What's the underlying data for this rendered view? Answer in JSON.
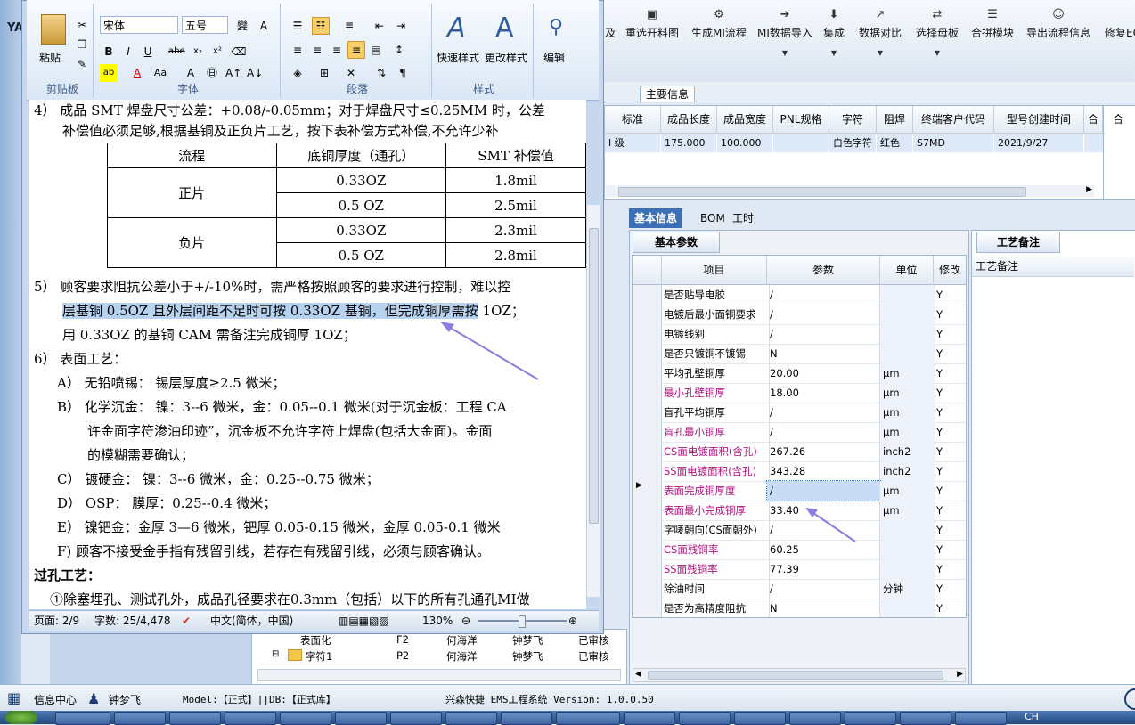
{
  "app": {
    "left_strip_label": "YA",
    "toolbar": [
      {
        "label": "及",
        "icon": "none"
      },
      {
        "label": "重选开料图",
        "icon": "picture-icon"
      },
      {
        "label": "生成MI流程",
        "icon": "flow-icon"
      },
      {
        "label": "MI数据导入",
        "icon": "import-icon"
      },
      {
        "label": "集成",
        "icon": "download-icon"
      },
      {
        "label": "数据对比",
        "icon": "compare-icon"
      },
      {
        "label": "选择母板",
        "icon": "shuffle-icon"
      },
      {
        "label": "合拼模块",
        "icon": "list-icon"
      },
      {
        "label": "导出流程信息",
        "icon": "smile-icon"
      },
      {
        "label": "修复ECR",
        "icon": "none"
      }
    ],
    "main_tab": "主要信息",
    "order_grid": {
      "headers": [
        "标准",
        "成品长度",
        "成品宽度",
        "PNL规格",
        "字符",
        "阻焊",
        "终端客户代码",
        "型号创建时间",
        "合"
      ],
      "row": [
        "I 级",
        "175.000",
        "100.000",
        "",
        "白色字符",
        "红色",
        "S7MD",
        "2021/9/27",
        ""
      ]
    },
    "right_panel_label": "合",
    "tabs": [
      "基本信息",
      "BOM",
      "工时"
    ],
    "basic_title": "基本参数",
    "param_headers": [
      "项目",
      "参数",
      "单位",
      "修改"
    ],
    "params": [
      {
        "name": "是否贴导电胶",
        "value": "/",
        "unit": "",
        "flag": "Y",
        "hl": false
      },
      {
        "name": "电镀后最小面铜要求",
        "value": "/",
        "unit": "",
        "flag": "Y",
        "hl": false
      },
      {
        "name": "电镀线别",
        "value": "/",
        "unit": "",
        "flag": "Y",
        "hl": false
      },
      {
        "name": "是否只镀铜不镀锡",
        "value": "N",
        "unit": "",
        "flag": "Y",
        "hl": false
      },
      {
        "name": "平均孔壁铜厚",
        "value": "20.00",
        "unit": "μm",
        "flag": "Y",
        "hl": false
      },
      {
        "name": "最小孔壁铜厚",
        "value": "18.00",
        "unit": "μm",
        "flag": "Y",
        "hl": true
      },
      {
        "name": "盲孔平均铜厚",
        "value": "/",
        "unit": "μm",
        "flag": "Y",
        "hl": false
      },
      {
        "name": "盲孔最小铜厚",
        "value": "/",
        "unit": "μm",
        "flag": "Y",
        "hl": true
      },
      {
        "name": "CS面电镀面积(含孔)",
        "value": "267.26",
        "unit": "inch2",
        "flag": "Y",
        "hl": true
      },
      {
        "name": "SS面电镀面积(含孔)",
        "value": "343.28",
        "unit": "inch2",
        "flag": "Y",
        "hl": true
      },
      {
        "name": "表面完成铜厚度",
        "value": "/",
        "unit": "μm",
        "flag": "Y",
        "hl": true
      },
      {
        "name": "表面最小完成铜厚",
        "value": "33.40",
        "unit": "μm",
        "flag": "Y",
        "hl": true
      },
      {
        "name": "字唛朝向(CS面朝外)",
        "value": "/",
        "unit": "",
        "flag": "Y",
        "hl": false
      },
      {
        "name": "CS面残铜率",
        "value": "60.25",
        "unit": "",
        "flag": "Y",
        "hl": true
      },
      {
        "name": "SS面残铜率",
        "value": "77.39",
        "unit": "",
        "flag": "Y",
        "hl": true
      },
      {
        "name": "除油时间",
        "value": "/",
        "unit": "分钟",
        "flag": "Y",
        "hl": false
      },
      {
        "name": "是否为高精度阻抗",
        "value": "N",
        "unit": "",
        "flag": "Y",
        "hl": false
      }
    ],
    "notes_title": "工艺备注",
    "notes_header": "工艺备注",
    "tree": [
      {
        "name": "表面化",
        "code": "F2",
        "p1": "何海洋",
        "p2": "钟梦飞",
        "status": "已审核"
      },
      {
        "name": "字符1",
        "code": "P2",
        "p1": "何海洋",
        "p2": "钟梦飞",
        "status": "已审核"
      }
    ],
    "status": {
      "info_center": "信息中心",
      "user": "钟梦飞",
      "model": "Model:【正式】||DB:【正式库】",
      "system": "兴森快捷 EMS工程系统 Version: 1.0.0.50"
    },
    "taskbar_clock": "CH"
  },
  "word": {
    "ribbon": {
      "clipboard_label": "剪贴板",
      "paste": "粘贴",
      "font_label": "字体",
      "font_name": "宋体",
      "font_size": "五号",
      "paragraph_label": "段落",
      "styles_label": "样式",
      "quick_style": "快速样式",
      "change_style": "更改样式",
      "edit": "编辑"
    },
    "doc": {
      "l1": "4） 成品 SMT 焊盘尺寸公差：+0.08/-0.05mm；对于焊盘尺寸≤0.25MM 时，公差",
      "l2": "补偿值必须足够,根据基铜及正负片工艺，按下表补偿方式补偿,不允许少补",
      "table_headers": [
        "流程",
        "底铜厚度（通孔）",
        "SMT 补偿值"
      ],
      "table_rows": [
        {
          "flow": "正片",
          "cu": "0.33OZ",
          "val": "1.8mil"
        },
        {
          "flow": "",
          "cu": "0.5 OZ",
          "val": "2.5mil"
        },
        {
          "flow": "负片",
          "cu": "0.33OZ",
          "val": "2.3mil"
        },
        {
          "flow": "",
          "cu": "0.5 OZ",
          "val": "2.8mil"
        }
      ],
      "l5a": "5） 顾客要求阻抗公差小于+/-10%时，需严格按照顾客的要求进行控制，难以控",
      "l5b_hl": "层基铜 0.5OZ 且外层间距不足时可按 0.33OZ 基铜，但完成铜厚需按",
      "l5b_tail": " 1OZ；",
      "l5c": "用 0.33OZ 的基铜 CAM 需备注完成铜厚 1OZ；",
      "l6": "6） 表面工艺：",
      "lA": "A） 无铅喷锡：  锡层厚度≥2.5 微米；",
      "lB": "B） 化学沉金：  镍：3--6 微米，金：0.05--0.1 微米(对于沉金板：工程 CA",
      "lB2": "许金面字符渗油印迹”，沉金板不允许字符上焊盘(包括大金面)。金面",
      "lB3": "的模糊需要确认；",
      "lC": "C） 镀硬金：    镍：3--6 微米，金：0.25--0.75 微米；",
      "lD": "D） OSP：        膜厚：0.25--0.4 微米；",
      "lE": "E） 镍钯金：金厚 3—6 微米，钯厚 0.05-0.15 微米，金厚 0.05-0.1 微米",
      "lF": "F) 顾客不接受金手指有残留引线，若存在有残留引线，必须与顾客确认。",
      "lvia": "过孔工艺：",
      "llast": "①除塞埋孔、测试孔外，成品孔径要求在0.3mm（包括）以下的所有孔通孔MI做"
    },
    "status": {
      "page": "页面: 2/9",
      "words": "字数: 25/4,478",
      "lang": "中文(简体，中国)",
      "zoom": "130%"
    }
  }
}
